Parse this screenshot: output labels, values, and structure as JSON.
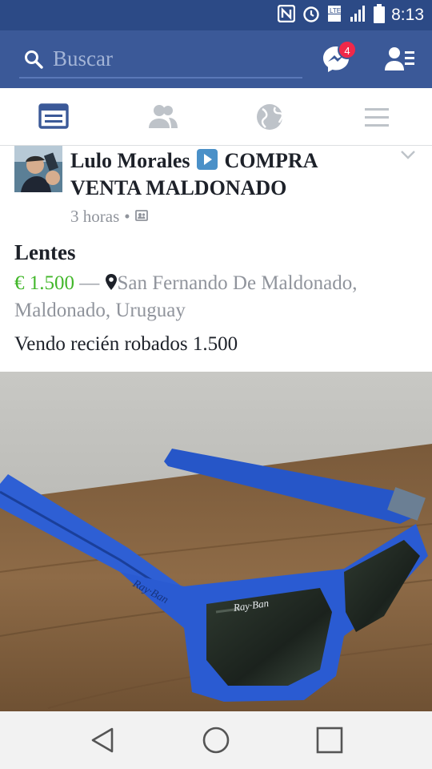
{
  "status_bar": {
    "time": "8:13",
    "icons": [
      "nfc-icon",
      "alarm-icon",
      "lte-icon",
      "signal-icon",
      "battery-icon"
    ]
  },
  "header": {
    "search_placeholder": "Buscar",
    "messenger_badge": "4",
    "icons": [
      "search-icon",
      "messenger-icon",
      "friend-requests-icon"
    ],
    "colors": {
      "bar": "#3b5998",
      "badge": "#f02849"
    }
  },
  "tabs": [
    {
      "name": "news-feed",
      "active": true
    },
    {
      "name": "friends",
      "active": false
    },
    {
      "name": "notifications-globe",
      "active": false
    },
    {
      "name": "menu",
      "active": false
    }
  ],
  "post": {
    "author": "Lulo Morales",
    "group": "COMPRA VENTA MALDONADO",
    "time": "3 horas",
    "separator": "•",
    "item_title": "Lentes",
    "price": "€ 1.500",
    "dash": "—",
    "location": "San Fernando De Maldonado, Maldonado, Uruguay",
    "description": "Vendo recién robados 1.500",
    "price_color": "#42b72a"
  },
  "photo": {
    "alt": "Gafas de sol azules con lentes oscuros sobre una mesa de madera",
    "logo_text": "Ray·Ban"
  },
  "nav_bar": {
    "buttons": [
      "back-icon",
      "home-icon",
      "recents-icon"
    ]
  }
}
